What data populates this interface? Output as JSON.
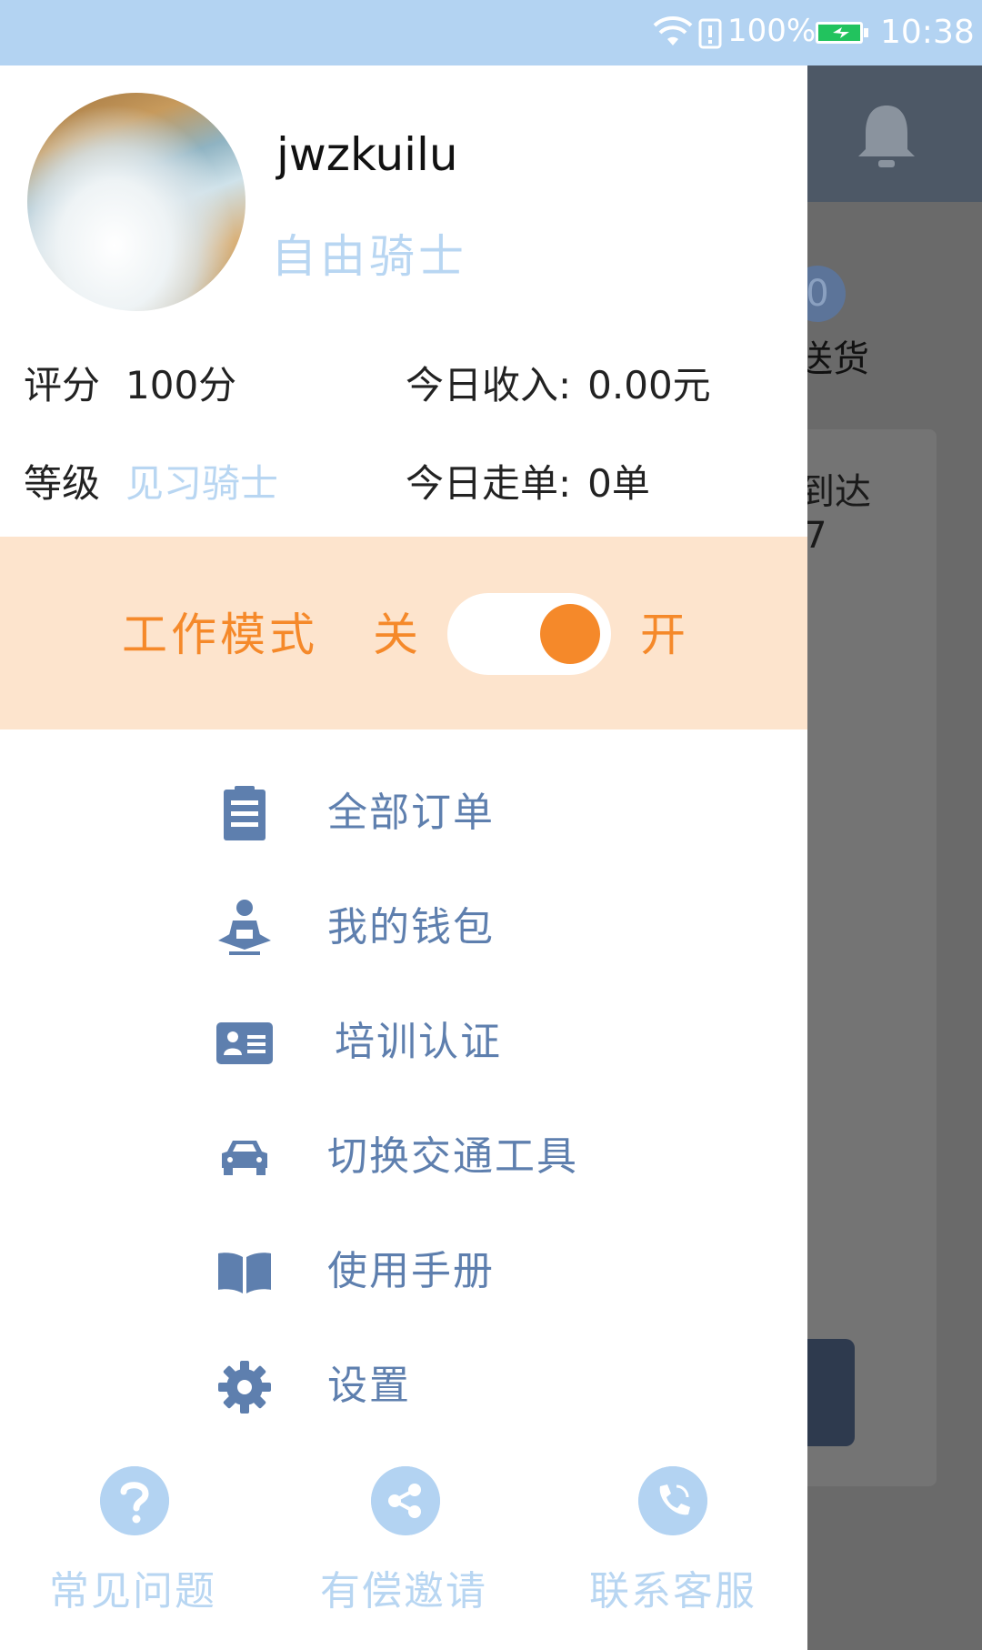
{
  "status_bar": {
    "battery_percent": "100%",
    "time": "10:38"
  },
  "background_app": {
    "badge": "0",
    "label_1": "送货",
    "label_2": "到达",
    "label_3": "7"
  },
  "drawer": {
    "username": "jwzkuilu",
    "role": "自由骑士",
    "stats": {
      "rating_label": "评分",
      "rating_value": "100分",
      "income_label": "今日收入:",
      "income_value": "0.00元",
      "level_label": "等级",
      "level_value": "见习骑士",
      "orders_label": "今日走单:",
      "orders_value": "0单"
    },
    "work_mode": {
      "label": "工作模式",
      "off": "关",
      "on": "开",
      "enabled": true
    },
    "menu": [
      {
        "label": "全部订单",
        "icon": "clipboard-icon"
      },
      {
        "label": "我的钱包",
        "icon": "wallet-person-icon"
      },
      {
        "label": "培训认证",
        "icon": "id-card-icon"
      },
      {
        "label": "切换交通工具",
        "icon": "car-icon"
      },
      {
        "label": "使用手册",
        "icon": "book-icon"
      },
      {
        "label": "设置",
        "icon": "gear-icon"
      }
    ],
    "bottom": [
      {
        "label": "常见问题",
        "icon": "question-icon"
      },
      {
        "label": "有偿邀请",
        "icon": "share-icon"
      },
      {
        "label": "联系客服",
        "icon": "phone-icon"
      }
    ]
  },
  "colors": {
    "status_bar": "#b3d3f2",
    "accent_orange": "#f5892a",
    "work_bar_bg": "#fde4cd",
    "menu_text": "#5e7fae",
    "light_blue": "#b8d6f2"
  }
}
